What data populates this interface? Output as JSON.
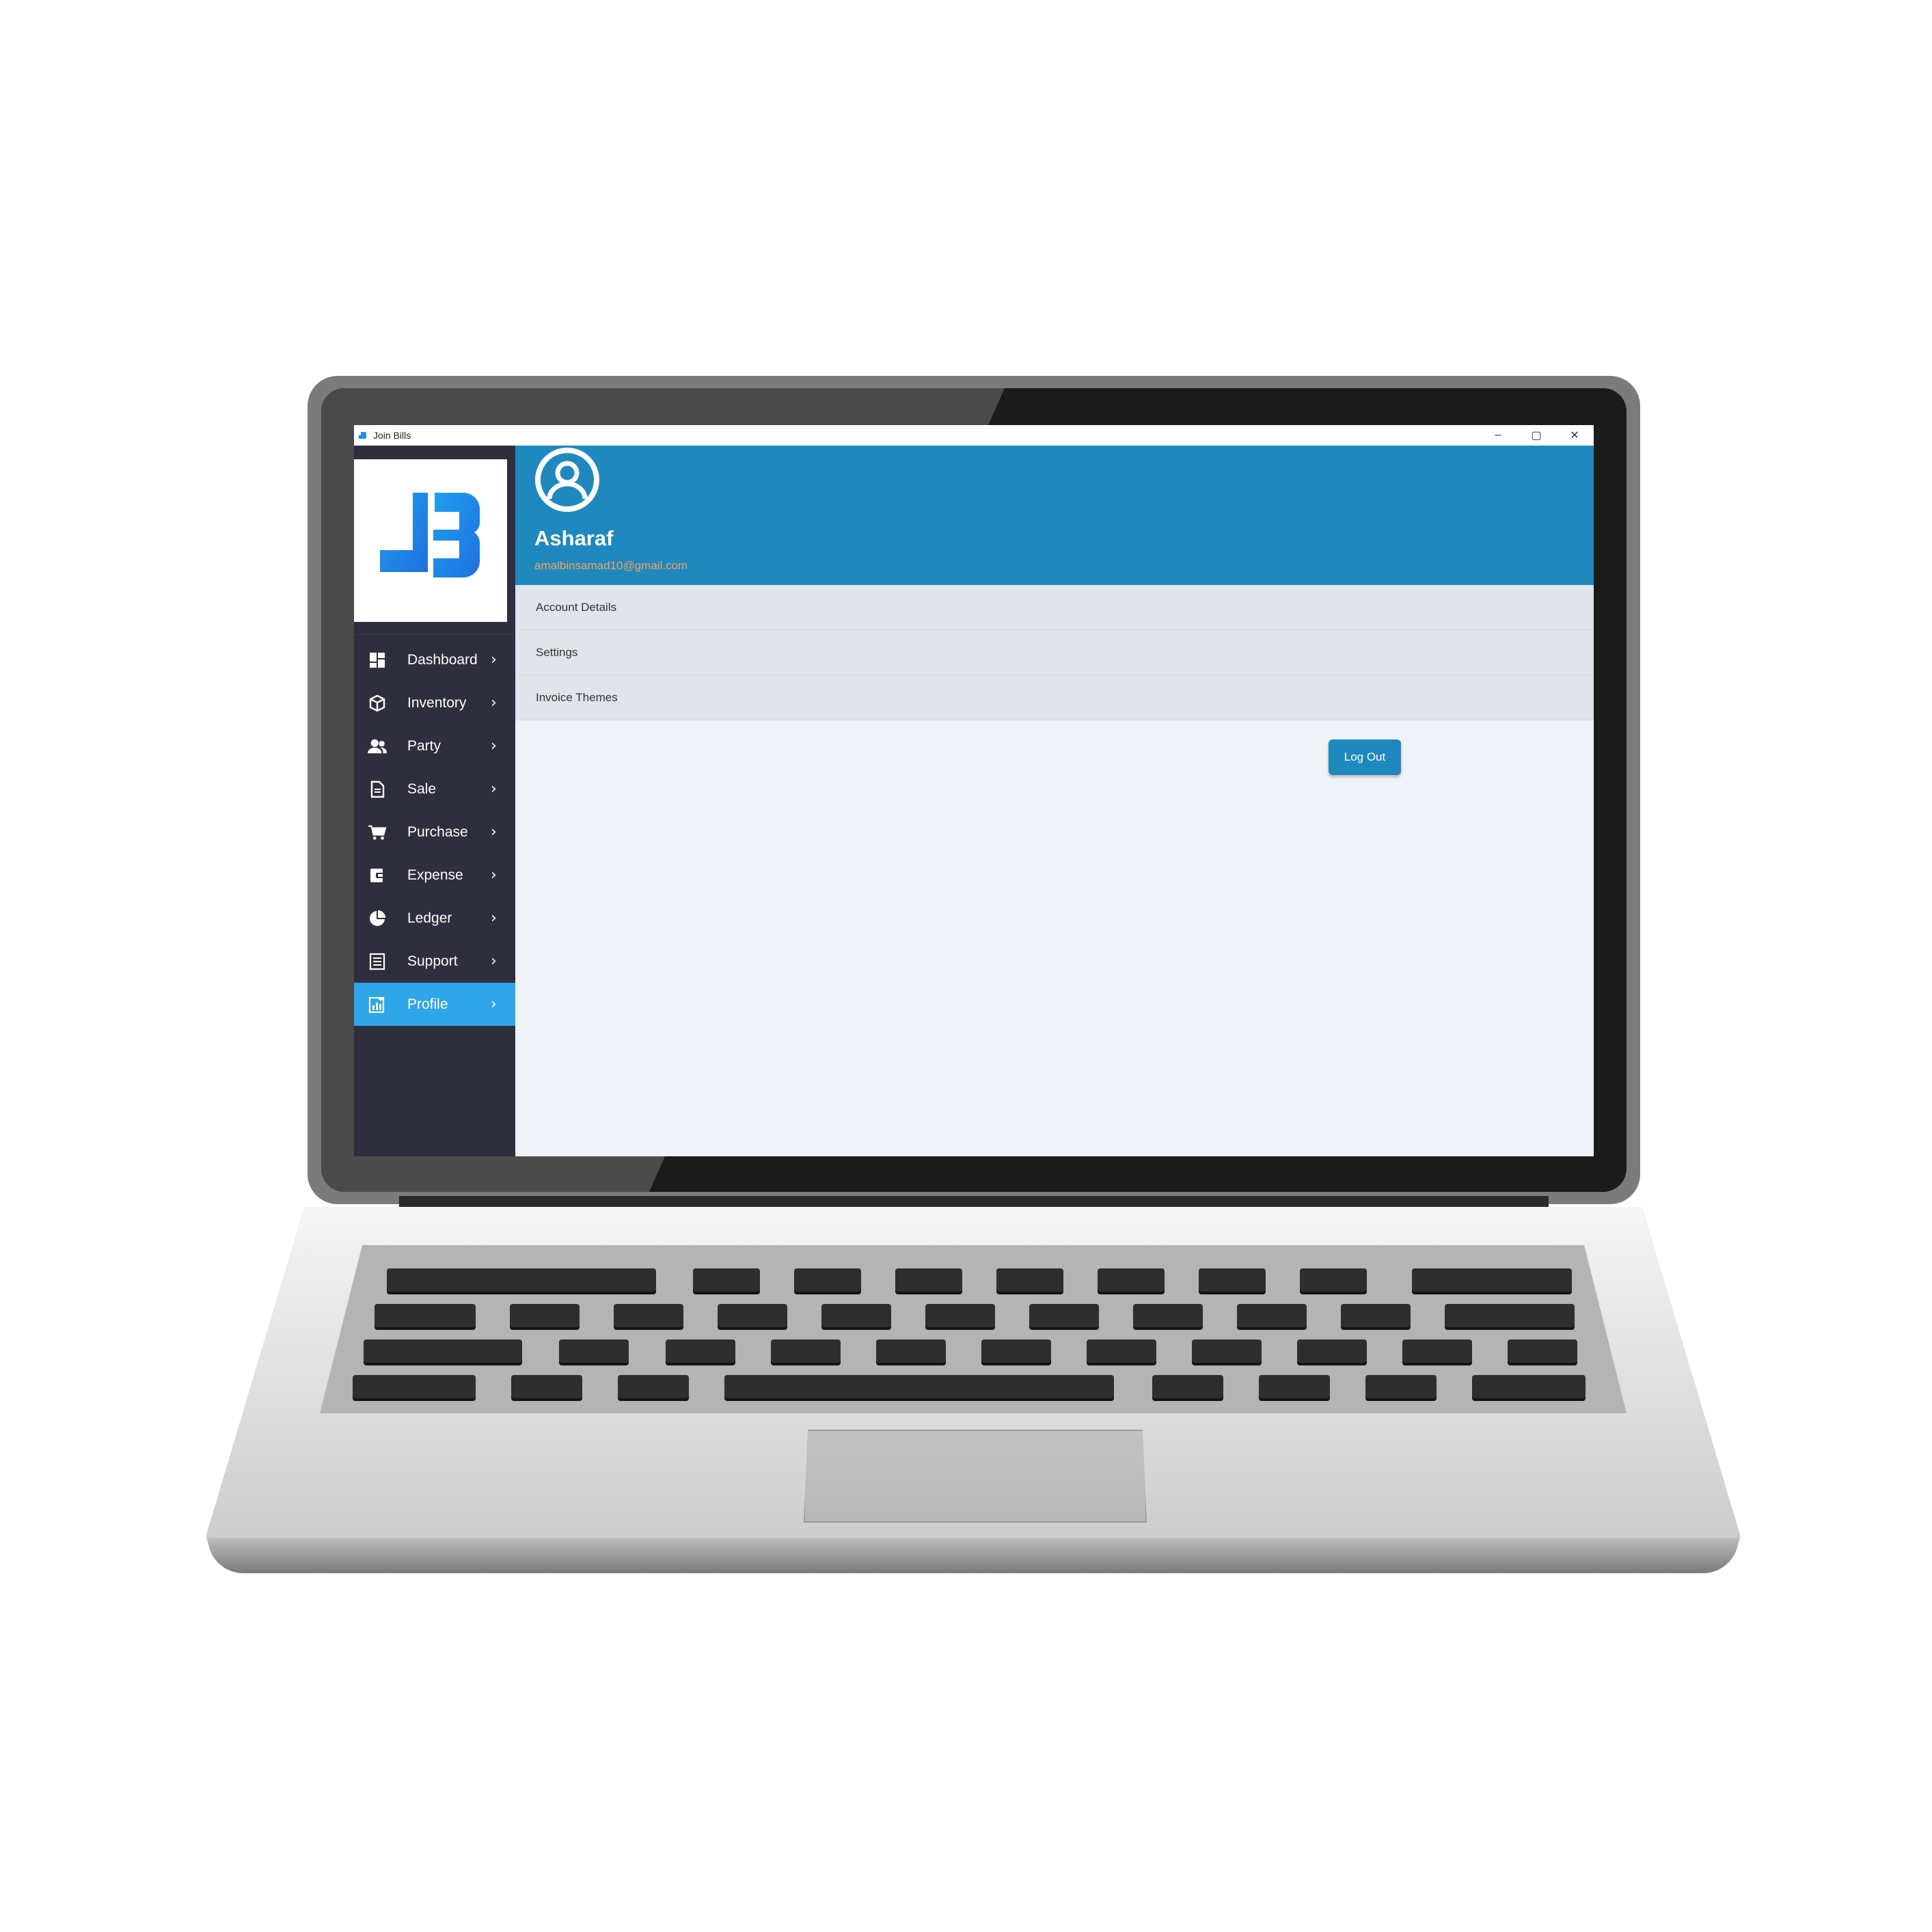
{
  "window": {
    "title": "Join Bills",
    "controls": {
      "minimize": "–",
      "maximize": "▢",
      "close": "✕"
    }
  },
  "sidebar": {
    "items": [
      {
        "label": "Dashboard",
        "icon": "dashboard-icon",
        "chevron": "›",
        "active": false
      },
      {
        "label": "Inventory",
        "icon": "box-icon",
        "chevron": "›",
        "active": false
      },
      {
        "label": "Party",
        "icon": "users-icon",
        "chevron": "›",
        "active": false
      },
      {
        "label": "Sale",
        "icon": "document-icon",
        "chevron": "›",
        "active": false
      },
      {
        "label": "Purchase",
        "icon": "cart-icon",
        "chevron": "›",
        "active": false
      },
      {
        "label": "Expense",
        "icon": "wallet-icon",
        "chevron": "›",
        "active": false
      },
      {
        "label": "Ledger",
        "icon": "pie-chart-icon",
        "chevron": "›",
        "active": false
      },
      {
        "label": "Support",
        "icon": "list-icon",
        "chevron": "›",
        "active": false
      },
      {
        "label": "Profile",
        "icon": "report-icon",
        "chevron": "›",
        "active": true
      }
    ]
  },
  "profile": {
    "name": "Asharaf",
    "email": "amalbinsamad10@gmail.com"
  },
  "menu": {
    "items": [
      "Account Details",
      "Settings",
      "Invoice Themes"
    ]
  },
  "actions": {
    "logout_label": "Log Out"
  },
  "colors": {
    "header_blue": "#1f88bf",
    "sidebar_bg": "#2e2e3e",
    "active_item": "#2fa6ea",
    "email_accent": "#f0a35a"
  }
}
